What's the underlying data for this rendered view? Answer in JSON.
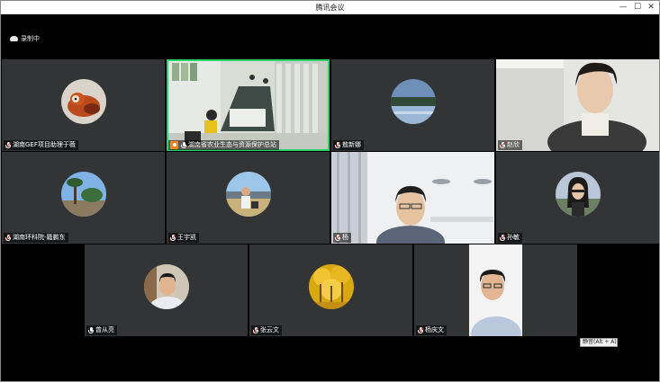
{
  "window": {
    "title": "腾讯会议",
    "minimize": "—",
    "maximize": "☐",
    "close": "✕"
  },
  "recording": {
    "label": "录制中"
  },
  "participants": [
    {
      "name": "湖南GEF项目助理于薇",
      "mic": "muted"
    },
    {
      "name": "湖南省农业生态与资源保护总站",
      "mic": "active",
      "host": true
    },
    {
      "name": "敖新娜",
      "mic": "muted"
    },
    {
      "name": "赵欣",
      "mic": "muted"
    },
    {
      "name": "湖南环科院-籍鹏东",
      "mic": "muted"
    },
    {
      "name": "王宇凯",
      "mic": "muted"
    },
    {
      "name": "杨",
      "mic": "muted"
    },
    {
      "name": "孙敏",
      "mic": "muted"
    },
    {
      "name": "曾从亮",
      "mic": "muted"
    },
    {
      "name": "张云文",
      "mic": "muted"
    },
    {
      "name": "杨庆文",
      "mic": "muted"
    }
  ],
  "tooltip": {
    "text": "静音(Alt + A)"
  },
  "colors": {
    "tile_bg": "#323436",
    "active_border": "#2bd36a",
    "host_badge": "#f5841f",
    "muted_slash": "#e53935"
  }
}
